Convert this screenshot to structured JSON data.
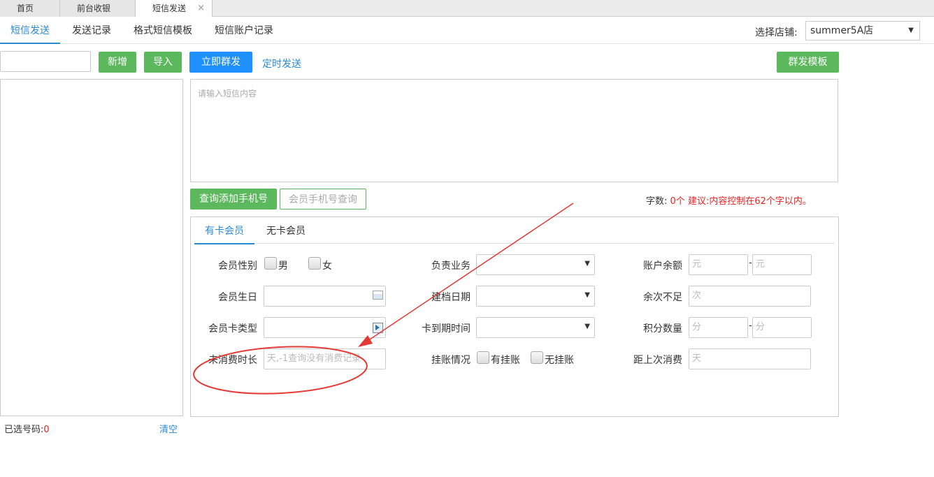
{
  "top_tabs": [
    {
      "label": "首页"
    },
    {
      "label": "前台收银"
    },
    {
      "label": "短信发送",
      "close": "×"
    }
  ],
  "nav": [
    "短信发送",
    "发送记录",
    "格式短信模板",
    "短信账户记录"
  ],
  "store": {
    "label": "选择店铺:",
    "value": "summer5A店"
  },
  "toolbar": {
    "add": "新增",
    "import": "导入",
    "send_now": "立即群发",
    "scheduled": "定时发送",
    "template": "群发模板"
  },
  "sms": {
    "placeholder": "请输入短信内容"
  },
  "query": {
    "add_phone": "查询添加手机号",
    "member_phone_query": "会员手机号查询",
    "count_label": "字数:",
    "count_value": "0个",
    "advice": "建议:内容控制在62个字以内。"
  },
  "filter_tabs": [
    "有卡会员",
    "无卡会员"
  ],
  "filters": {
    "gender": {
      "label": "会员性别",
      "male": "男",
      "female": "女"
    },
    "business": {
      "label": "负责业务"
    },
    "balance": {
      "label": "账户余额",
      "ph_from": "元",
      "ph_to": "元",
      "sep": "-"
    },
    "birthday": {
      "label": "会员生日"
    },
    "created": {
      "label": "建档日期"
    },
    "remaining": {
      "label": "余次不足",
      "ph": "次"
    },
    "card_type": {
      "label": "会员卡类型"
    },
    "card_expiry": {
      "label": "卡到期时间"
    },
    "points": {
      "label": "积分数量",
      "ph_from": "分",
      "ph_to": "分",
      "sep": "-"
    },
    "inactive": {
      "label": "未消费时长",
      "ph": "天,-1查询没有消费记录"
    },
    "credit": {
      "label": "挂账情况",
      "yes": "有挂账",
      "no": "无挂账"
    },
    "last_visit": {
      "label": "距上次消费",
      "ph": "天"
    }
  },
  "selected": {
    "label": "已选号码:",
    "count": "0",
    "clear": "清空"
  },
  "colors": {
    "accent_blue": "#2b8ad4",
    "green": "#5cb85c",
    "annotation_red": "#e53935"
  }
}
